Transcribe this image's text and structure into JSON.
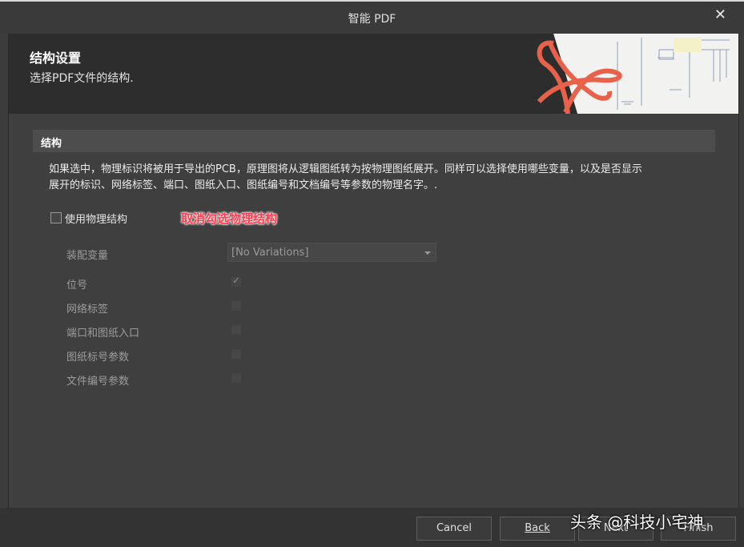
{
  "window": {
    "title": "智能 PDF",
    "close_glyph": "✕"
  },
  "header": {
    "title": "结构设置",
    "subtitle": "选择PDF文件的结构."
  },
  "section": {
    "title": "结构"
  },
  "description": {
    "line1": "如果选中，物理标识将被用于导出的PCB，原理图将从逻辑图纸转为按物理图纸展开。同样可以选择使用哪些变量，以及是否显示",
    "line2": "展开的标识、网络标签、端口、图纸入口、图纸编号和文档编号等参数的物理名字。."
  },
  "use_physical": {
    "label": "使用物理结构",
    "checked": false
  },
  "annotation": "取消勾选物理结构",
  "variant": {
    "label": "装配变量",
    "value": "[No Variations]"
  },
  "options": [
    {
      "label": "位号",
      "checked": true
    },
    {
      "label": "网络标签",
      "checked": false
    },
    {
      "label": "端口和图纸入口",
      "checked": false
    },
    {
      "label": "图纸标号参数",
      "checked": false
    },
    {
      "label": "文件编号参数",
      "checked": false
    }
  ],
  "buttons": {
    "cancel": "Cancel",
    "back": "Back",
    "next": "Next",
    "finish": "Finish"
  },
  "watermark": "头条 @科技小宅神"
}
